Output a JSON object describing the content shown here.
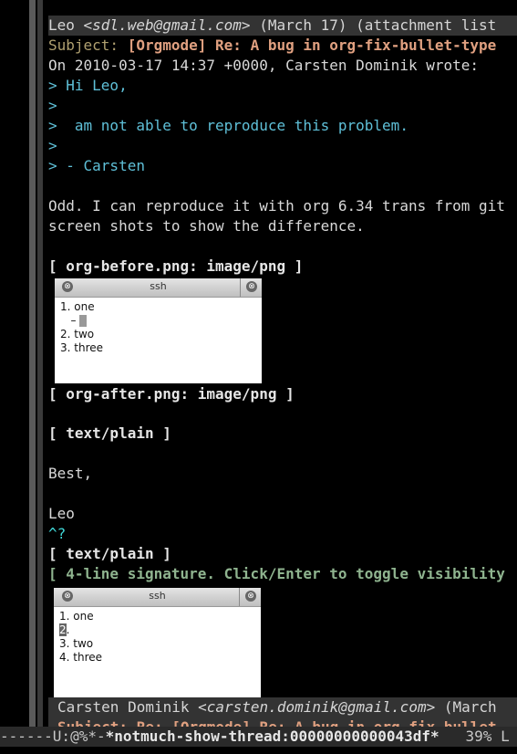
{
  "header": {
    "from_name": "Leo ",
    "from_email": "<sdl.web@gmail.com>",
    "from_rest": " (March 17) (attachment list",
    "subject_key": "Subject: ",
    "subject_val": "[Orgmode] Re: A bug in org-fix-bullet-type"
  },
  "body": {
    "intro": "On 2010-03-17 14:37 +0000, Carsten Dominik wrote:",
    "quote1": "> Hi Leo,",
    "quote2": ">",
    "quote3": ">  am not able to reproduce this problem.",
    "quote4": ">",
    "quote5": "> - Carsten",
    "para1": "Odd. I can reproduce it with org 6.34 trans from git",
    "para2": "screen shots to show the difference.",
    "att1": "[ org-before.png: image/png ]",
    "att2": "[ org-after.png: image/png ]",
    "att3": "[ text/plain ]",
    "best": "Best,",
    "name": "Leo",
    "ctrl": "^?",
    "att4": "[ text/plain ]",
    "sig": "[ 4-line signature. Click/Enter to toggle visibility"
  },
  "shot1": {
    "title": "ssh",
    "close": "⊗",
    "lines": [
      "1. one",
      "   – ",
      "2. two",
      "3. three"
    ]
  },
  "shot2": {
    "title": "ssh",
    "close": "⊗",
    "line1": "1. one",
    "line2_num": "2",
    "line2_rest": ".",
    "line3": "3. two",
    "line4": "4. three"
  },
  "next": {
    "from_name": "Carsten Dominik ",
    "from_email": "<carsten.dominik@gmail.com>",
    "from_rest": " (March",
    "subject": "Subject: Re: [Orgmode] Re: A bug in org-fix-bullet"
  },
  "modeline": {
    "prefix": "------U:@%*-",
    "buffer": "*notmuch-show-thread:00000000000043df*",
    "pos": "   39% L"
  }
}
